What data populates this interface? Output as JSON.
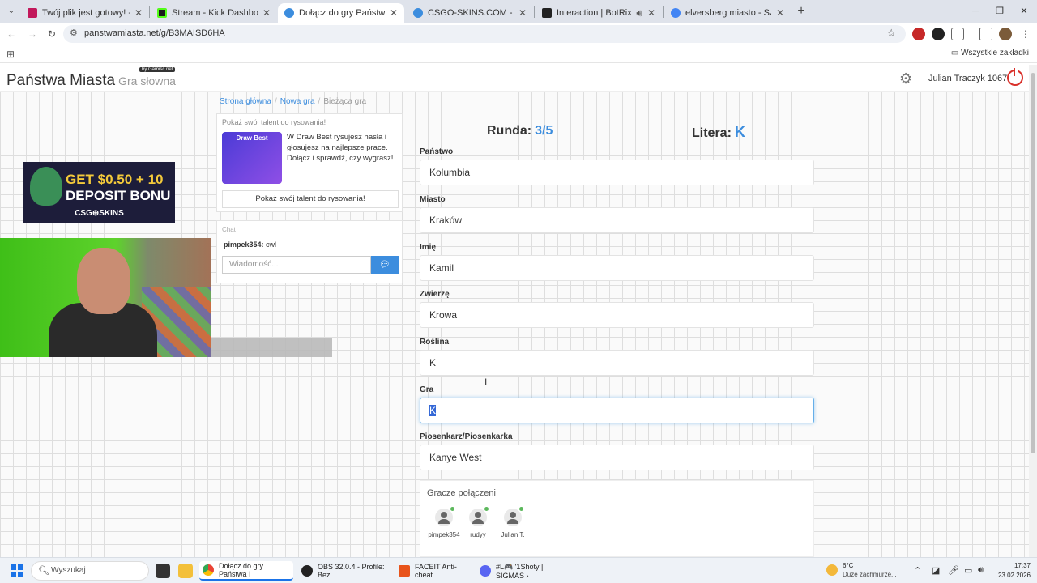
{
  "tabs": [
    {
      "title": "Twój plik jest gotowy! - noTube",
      "color": "#c2185b"
    },
    {
      "title": "Stream - Kick Dashboard",
      "color": "#1a1a1a"
    },
    {
      "title": "Dołącz do gry Państwa Miasta",
      "color": "#3c8dde"
    },
    {
      "title": "CSGO-SKINS.COM - Najlepsze",
      "color": "#3c8dde"
    },
    {
      "title": "Interaction | BotRix — Clou",
      "color": "#222"
    },
    {
      "title": "elversberg miasto - Szukaj w Go",
      "color": "#4285f4"
    }
  ],
  "address": {
    "url": "panstwamiasta.net/g/B3MAISD6HA"
  },
  "bookmarks": {
    "all": "Wszystkie zakładki"
  },
  "site": {
    "brand": "Państwa Miasta",
    "brand_sub": "Gra słowna",
    "by": "by Gamisc.net",
    "user": "Julian Traczyk 1067"
  },
  "breadcrumb": {
    "home": "Strona główna",
    "new_game": "Nowa gra",
    "current": "Bieżąca gra"
  },
  "promo": {
    "title": "Pokaż swój talent do rysowania!",
    "thumb_label": "Draw Best",
    "text": "W Draw Best rysujesz hasła i głosujesz na najlepsze prace. Dołącz i sprawdź, czy wygrasz!",
    "button": "Pokaż swój talent do rysowania!"
  },
  "chat": {
    "title": "Chat",
    "author": "pimpek354:",
    "message": "cwl",
    "placeholder": "Wiadomość..."
  },
  "ad": {
    "line1_a": "GET ",
    "line1_b": "$0.50 + 10",
    "line2": "DEPOSIT BONU",
    "logo": "CSG⊕SKINS"
  },
  "game": {
    "round_label": "Runda:",
    "round_value": "3/5",
    "letter_label": "Litera:",
    "letter_value": "K",
    "fields": [
      {
        "label": "Państwo",
        "value": "Kolumbia"
      },
      {
        "label": "Miasto",
        "value": "Kraków"
      },
      {
        "label": "Imię",
        "value": "Kamil"
      },
      {
        "label": "Zwierzę",
        "value": "Krowa"
      },
      {
        "label": "Roślina",
        "value": "K"
      },
      {
        "label": "Gra",
        "value": "K"
      },
      {
        "label": "Piosenkarz/Piosenkarka",
        "value": "Kanye West"
      }
    ],
    "players_title": "Gracze połączeni",
    "players": [
      "pimpek354",
      "rudyy",
      "Julian T."
    ]
  },
  "taskbar": {
    "search": "Wyszukaj",
    "items": [
      "Dołącz do gry Państwa I",
      "OBS 32.0.4 - Profile: Bez",
      "FACEIT Anti-cheat",
      "#L🎮 '1Shoty | SIGMAS ›"
    ],
    "weather_temp": "6°C",
    "weather_desc": "Duże zachmurze...",
    "time": "17:37",
    "date": "23.02.2026"
  }
}
